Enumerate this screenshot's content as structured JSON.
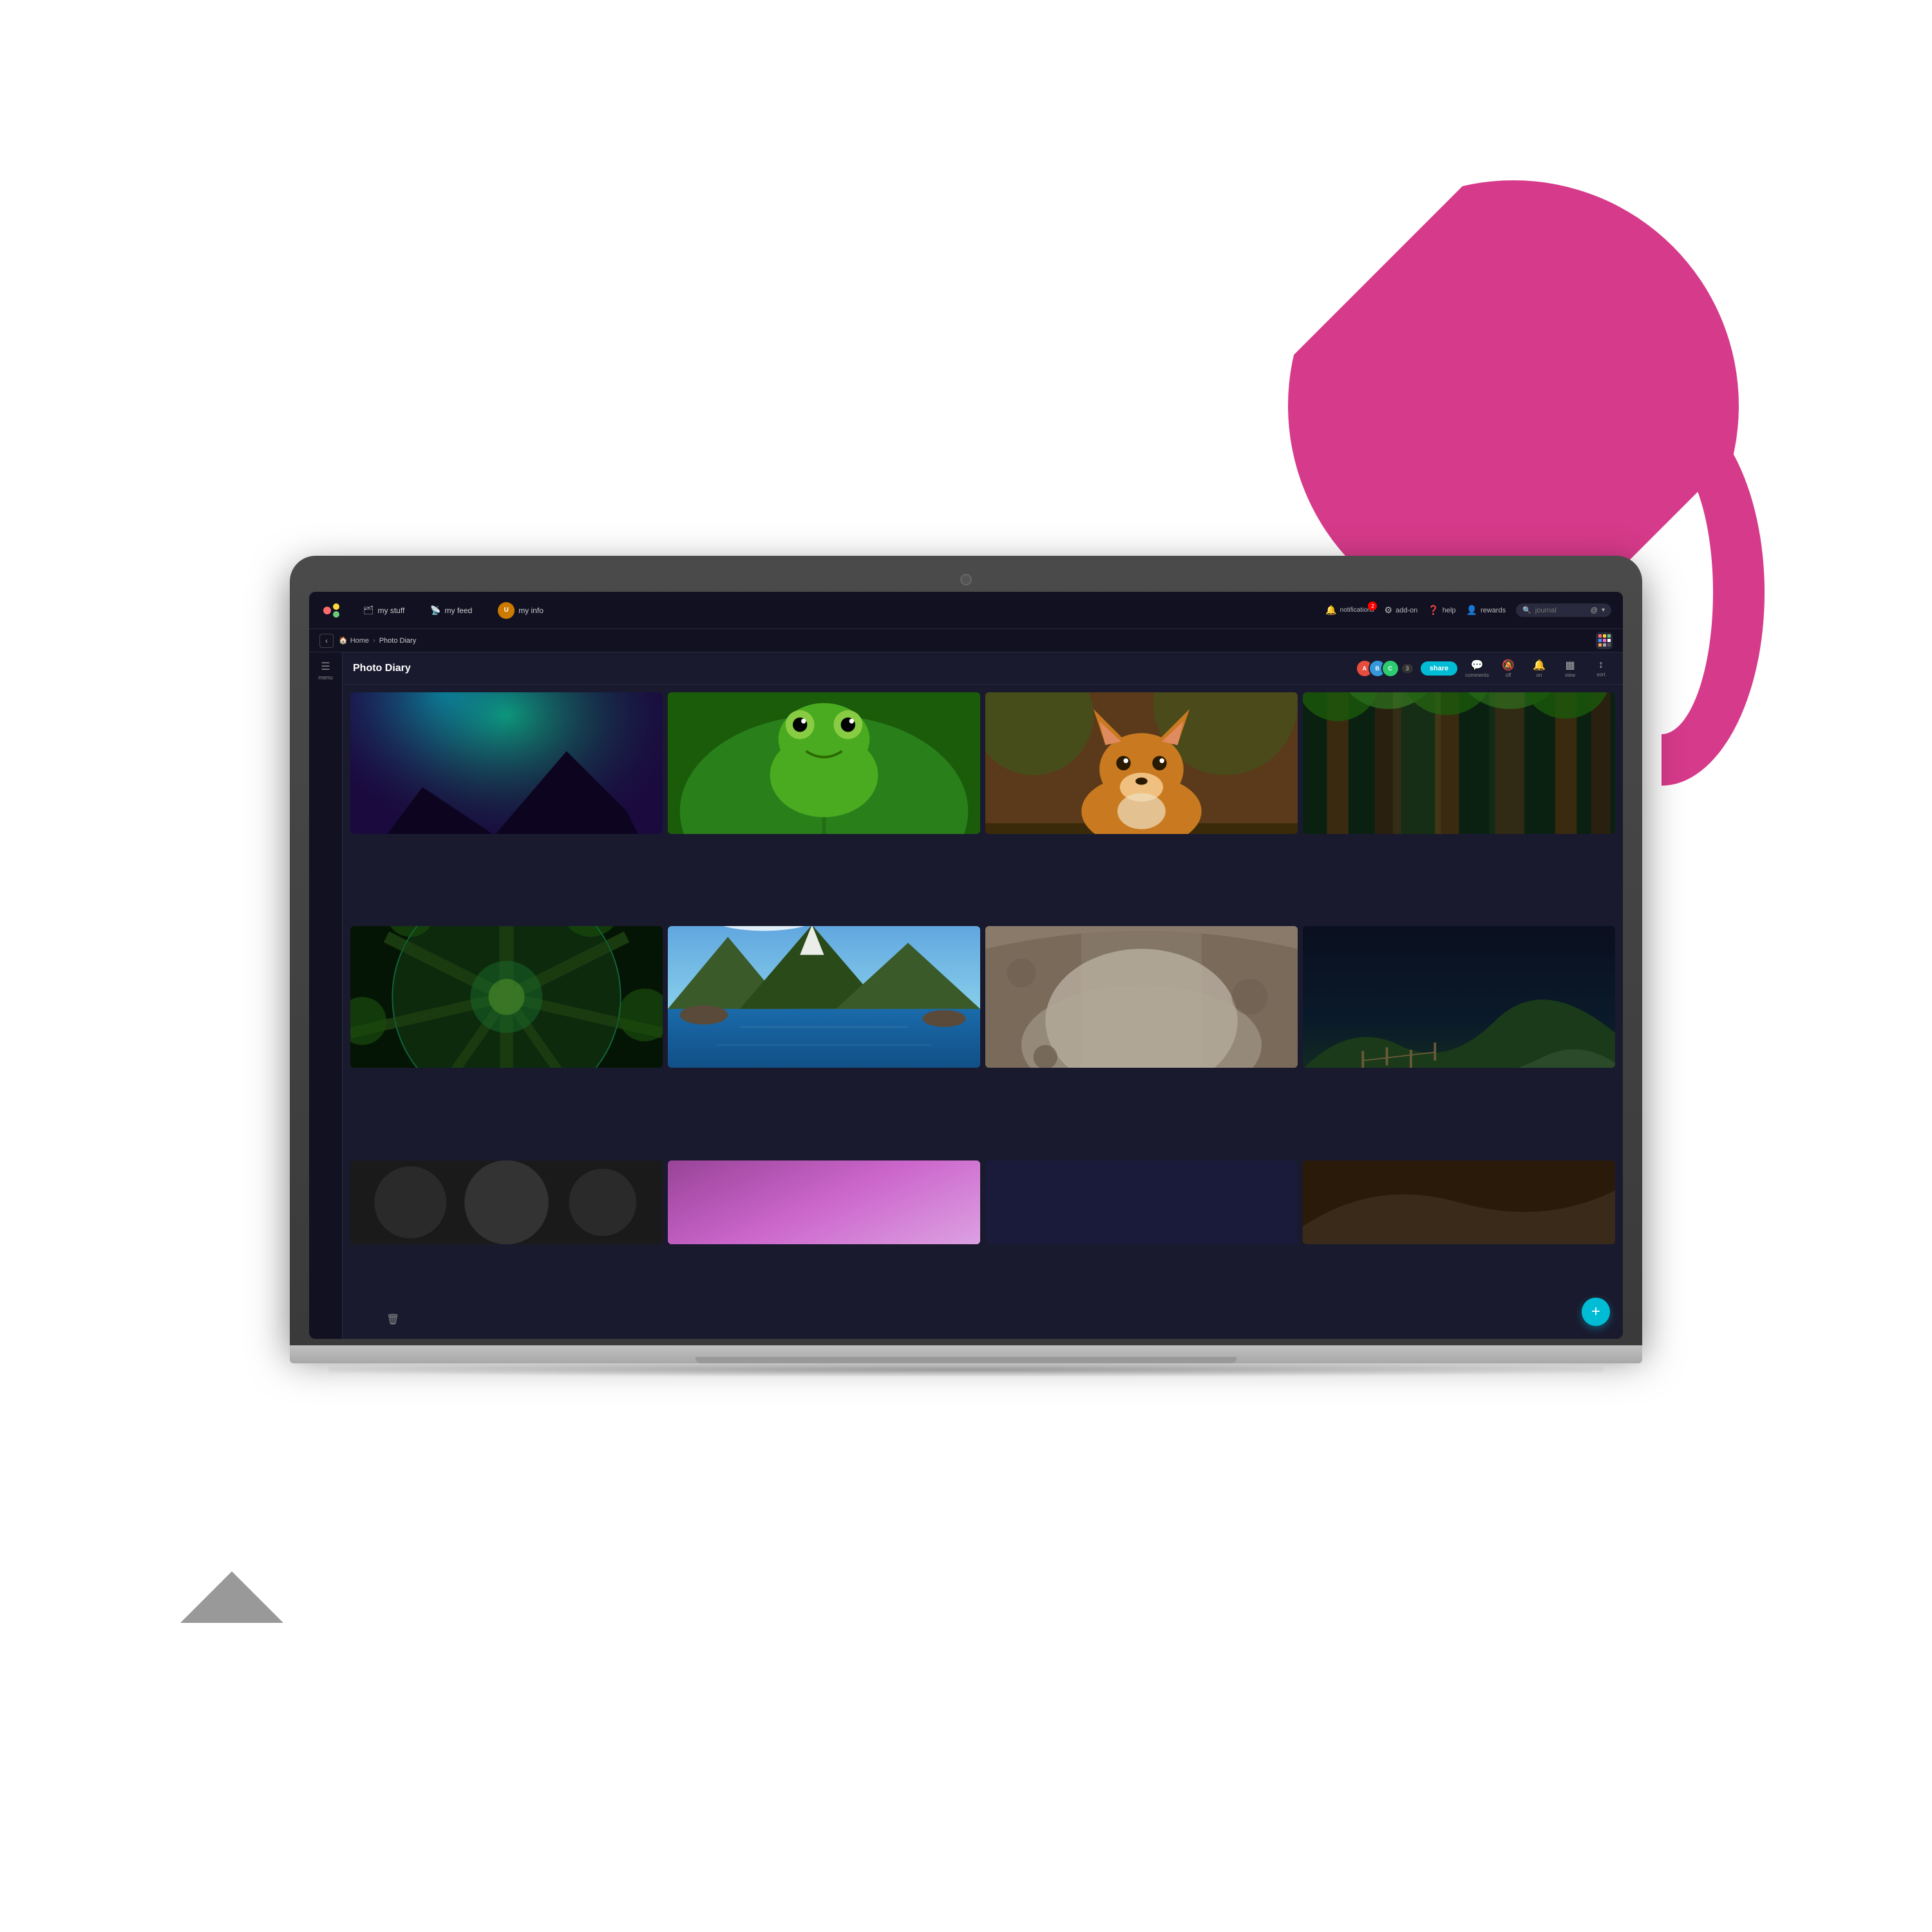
{
  "scene": {
    "pink_shape_color": "#d63a8a",
    "background": "#ffffff"
  },
  "topnav": {
    "logo_label": "oo",
    "tabs": [
      {
        "id": "my-stuff",
        "label": "my stuff",
        "icon": "🗂"
      },
      {
        "id": "my-feed",
        "label": "my feed",
        "icon": "📡"
      },
      {
        "id": "my-info",
        "label": "my info",
        "icon": ""
      }
    ],
    "my_info_has_avatar": true,
    "right_items": [
      {
        "id": "notifications",
        "label": "notifications",
        "icon": "🔔",
        "badge": "2"
      },
      {
        "id": "add-on",
        "label": "add-on",
        "icon": "🔧"
      },
      {
        "id": "help",
        "label": "help",
        "icon": "❓"
      },
      {
        "id": "rewards",
        "label": "rewards",
        "icon": "👤"
      }
    ],
    "search_placeholder": "journal",
    "search_icon": "@",
    "dropdown_icon": "▾"
  },
  "breadcrumb": {
    "back_icon": "‹",
    "home_label": "Home",
    "separator": "›",
    "current": "Photo Diary",
    "grid_dots_colors": [
      "#ff6b6b",
      "#ffd93d",
      "#6bcb77",
      "#4d96ff",
      "#ff6bcd",
      "#ffffff",
      "#ff9f43",
      "#aaa",
      "#555"
    ]
  },
  "sidebar": {
    "items": [
      {
        "id": "menu",
        "label": "menu",
        "icon": "☰"
      }
    ]
  },
  "page_header": {
    "title": "Photo Diary",
    "share_button": "share",
    "avatars": [
      {
        "color": "#e74c3c",
        "initials": "A"
      },
      {
        "color": "#3498db",
        "initials": "B"
      },
      {
        "color": "#2ecc71",
        "initials": "C"
      }
    ],
    "avatar_count": "3",
    "actions": [
      {
        "id": "comments",
        "label": "comments",
        "icon": "💬"
      },
      {
        "id": "off",
        "label": "off",
        "icon": "🔔"
      },
      {
        "id": "on",
        "label": "on",
        "icon": "🔔"
      },
      {
        "id": "view",
        "label": "view",
        "icon": "📋"
      },
      {
        "id": "sort",
        "label": "sort",
        "icon": "↕"
      }
    ]
  },
  "photo_grid": {
    "rows": [
      [
        {
          "id": "aurora",
          "class": "photo-aurora",
          "alt": "Aurora borealis over mountains"
        },
        {
          "id": "frog",
          "class": "photo-frog",
          "alt": "Green tree frog on leaf"
        },
        {
          "id": "fox",
          "class": "photo-fox",
          "alt": "Red fox in nature"
        },
        {
          "id": "forest",
          "class": "photo-forest",
          "alt": "Sunlit forest path"
        }
      ],
      [
        {
          "id": "trees",
          "class": "photo-trees",
          "alt": "Looking up through trees"
        },
        {
          "id": "lake",
          "class": "photo-lake",
          "alt": "Mountain lake landscape"
        },
        {
          "id": "arch",
          "class": "photo-arch",
          "alt": "Rock arch with misty background"
        },
        {
          "id": "hills",
          "class": "photo-hills",
          "alt": "Rolling green hills at night"
        }
      ],
      [
        {
          "id": "partial1",
          "class": "photo-partial1",
          "alt": "Partial image 1"
        },
        {
          "id": "partial2",
          "class": "photo-partial2",
          "alt": "Purple gradient partial"
        },
        {
          "id": "partial3",
          "class": "photo-partial3",
          "alt": "Dark blue partial"
        },
        {
          "id": "partial4",
          "class": "photo-partial4",
          "alt": "Brown partial"
        }
      ]
    ],
    "add_button_icon": "+",
    "delete_icon": "🗑"
  }
}
